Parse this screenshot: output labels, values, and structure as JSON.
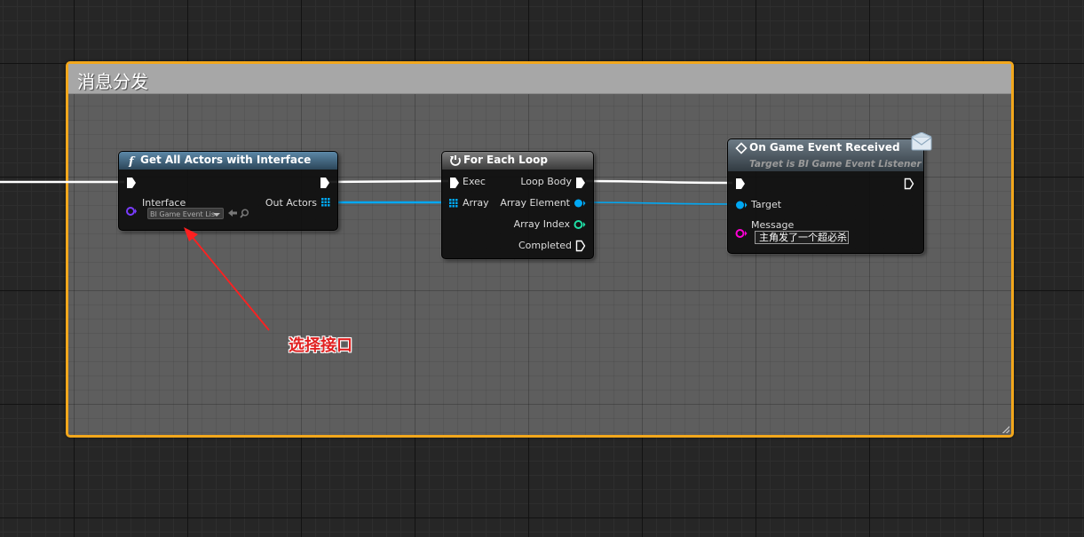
{
  "comment": {
    "title": "消息分发",
    "border_color": "#f2a71c"
  },
  "nodes": {
    "get_all_actors": {
      "title": "Get All Actors with Interface",
      "interface_label": "Interface",
      "interface_value": "BI Game Event Lis",
      "out_actors_label": "Out Actors"
    },
    "for_each": {
      "title": "For Each Loop",
      "exec_label": "Exec",
      "array_label": "Array",
      "loop_body_label": "Loop Body",
      "array_element_label": "Array Element",
      "array_index_label": "Array Index",
      "completed_label": "Completed"
    },
    "event_received": {
      "title": "On Game Event Received",
      "subtitle": "Target is BI Game Event Listener",
      "target_label": "Target",
      "message_label": "Message",
      "message_value": "主角发了一个超必杀"
    }
  },
  "annotation": {
    "text": "选择接口",
    "color": "#e02020"
  },
  "colors": {
    "exec_wire": "#ffffff",
    "object_wire": "#00a8f4",
    "interface_pin": "#7a3cff",
    "int_pin": "#1fe0a6",
    "string_pin": "#ff00d4"
  }
}
